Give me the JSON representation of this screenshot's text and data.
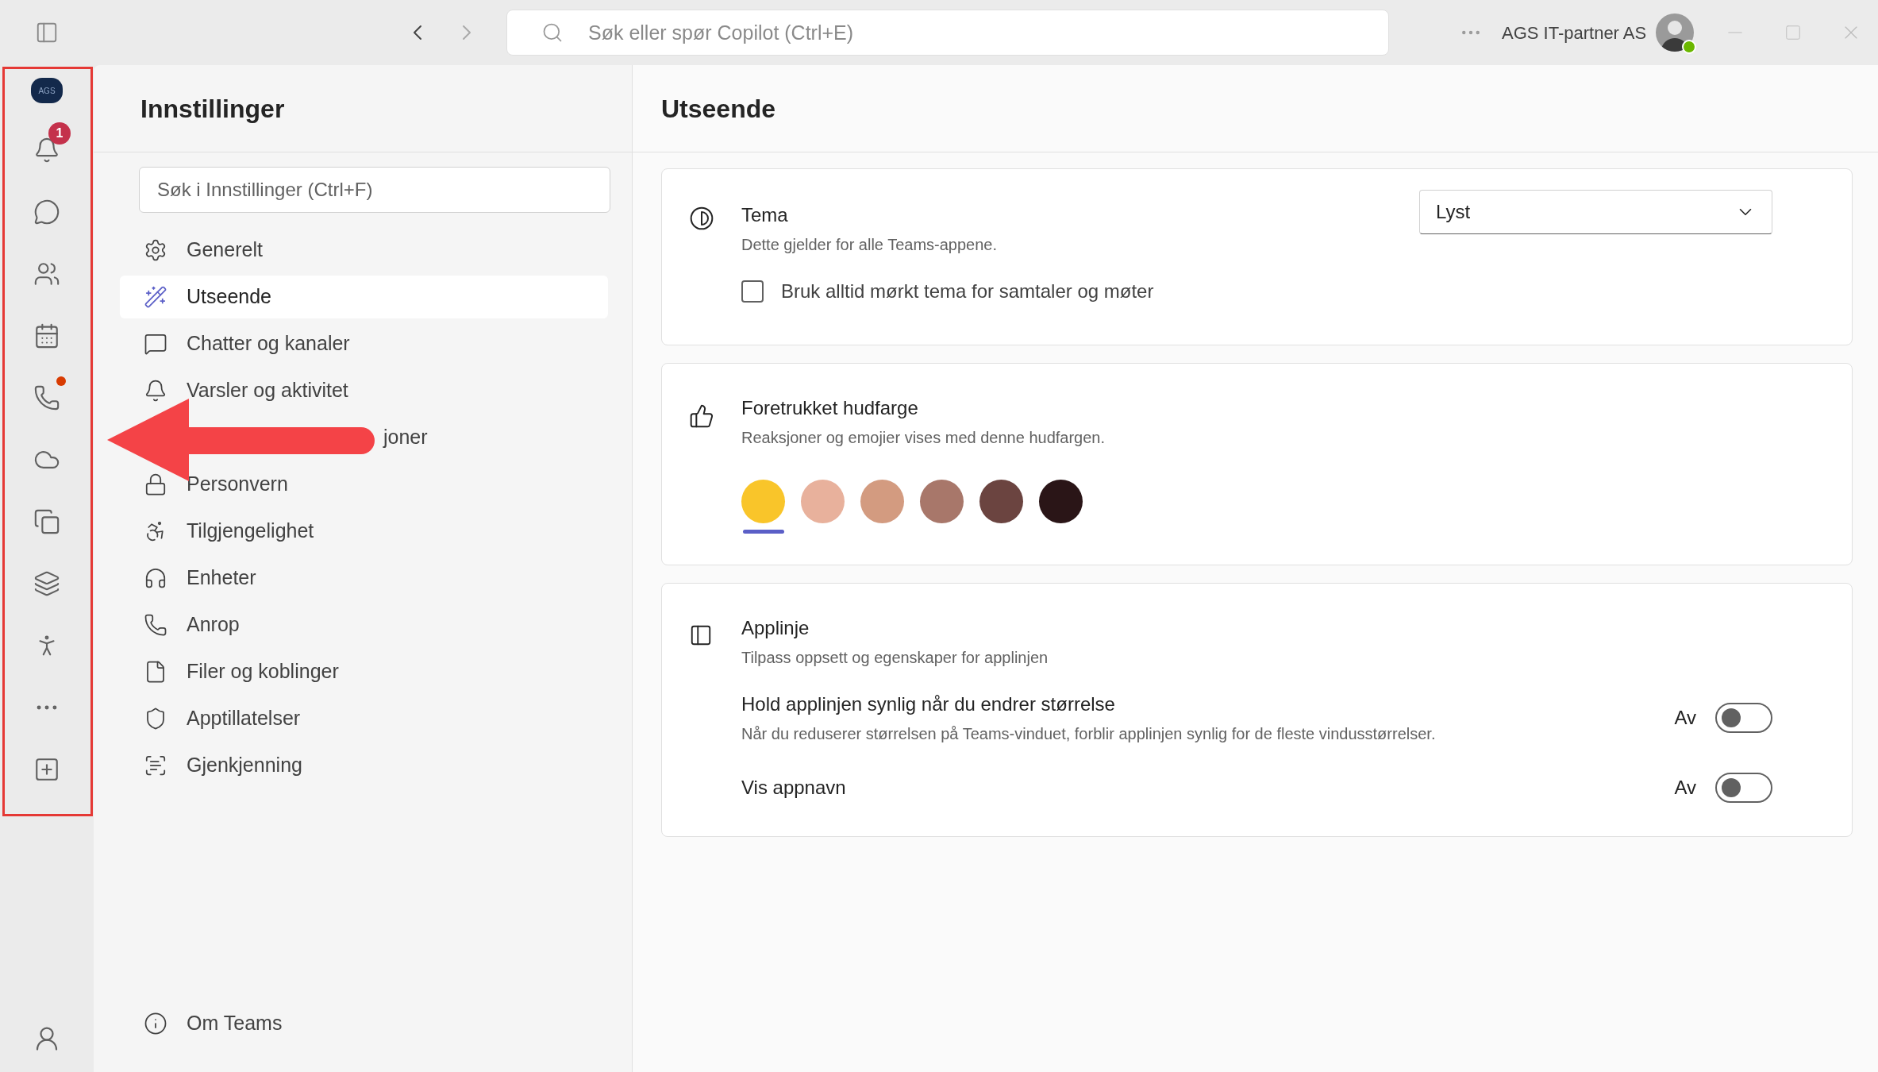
{
  "titlebar": {
    "search_placeholder": "Søk eller spør Copilot (Ctrl+E)",
    "account": "AGS IT-partner AS"
  },
  "rail": {
    "logo": "AGS",
    "items": [
      {
        "kind": "activity",
        "badge": "1",
        "dot": false
      },
      {
        "kind": "chat",
        "dot": false
      },
      {
        "kind": "teams",
        "dot": false
      },
      {
        "kind": "calendar",
        "dot": false
      },
      {
        "kind": "calls",
        "dot": true
      },
      {
        "kind": "cloud",
        "dot": false
      },
      {
        "kind": "copilot",
        "dot": false
      },
      {
        "kind": "planner",
        "dot": false
      },
      {
        "kind": "app",
        "dot": false
      },
      {
        "kind": "more",
        "dot": false
      },
      {
        "kind": "add",
        "dot": false
      }
    ]
  },
  "settings": {
    "title": "Innstillinger",
    "search_placeholder": "Søk i Innstillinger (Ctrl+F)",
    "items": [
      {
        "kind": "general",
        "label": "Generelt",
        "selected": false
      },
      {
        "kind": "appearance",
        "label": "Utseende",
        "selected": true
      },
      {
        "kind": "chat",
        "label": "Chatter og kanaler",
        "selected": false
      },
      {
        "kind": "notifications",
        "label": "Varsler og aktivitet",
        "selected": false
      },
      {
        "kind": "covered",
        "label": "joner",
        "selected": false
      },
      {
        "kind": "privacy",
        "label": "Personvern",
        "selected": false
      },
      {
        "kind": "accessibility",
        "label": "Tilgjengelighet",
        "selected": false
      },
      {
        "kind": "devices",
        "label": "Enheter",
        "selected": false
      },
      {
        "kind": "calls",
        "label": "Anrop",
        "selected": false
      },
      {
        "kind": "files",
        "label": "Filer og koblinger",
        "selected": false
      },
      {
        "kind": "permissions",
        "label": "Apptillatelser",
        "selected": false
      },
      {
        "kind": "recognition",
        "label": "Gjenkjenning",
        "selected": false
      }
    ],
    "about": "Om Teams"
  },
  "main": {
    "title": "Utseende",
    "theme": {
      "title": "Tema",
      "subtitle": "Dette gjelder for alle Teams-appene.",
      "dropdown": "Lyst",
      "checkbox": {
        "label": "Bruk alltid mørkt tema for samtaler og møter",
        "checked": false
      }
    },
    "skin": {
      "title": "Foretrukket hudfarge",
      "subtitle": "Reaksjoner og emojier vises med denne hudfargen.",
      "swatches": [
        {
          "color": "#f9c52a",
          "selected": true
        },
        {
          "color": "#e8b19c",
          "selected": false
        },
        {
          "color": "#d39b80",
          "selected": false
        },
        {
          "color": "#a8776a",
          "selected": false
        },
        {
          "color": "#6b4440",
          "selected": false
        },
        {
          "color": "#2a1517",
          "selected": false
        }
      ]
    },
    "appbar": {
      "title": "Applinje",
      "subtitle": "Tilpass oppsett og egenskaper for applinjen",
      "toggles": [
        {
          "label": "Hold applinjen synlig når du endrer størrelse",
          "description": "Når du reduserer størrelsen på Teams-vinduet, forblir applinjen synlig for de fleste vindusstørrelser.",
          "state_label": "Av",
          "on": false
        },
        {
          "label": "Vis appnavn",
          "state_label": "Av",
          "on": false
        }
      ]
    }
  },
  "annotations": {
    "outline": true,
    "arrow": true
  }
}
